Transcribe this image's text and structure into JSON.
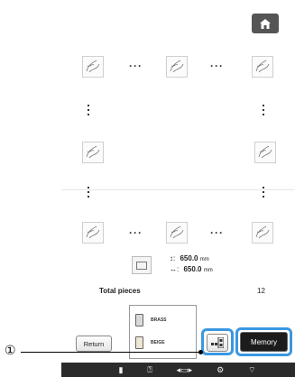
{
  "header": {
    "home_icon": "home-icon"
  },
  "layout_summary": {
    "width_value": "650.0",
    "height_value": "650.0",
    "unit": "mm",
    "total_label": "Total pieces",
    "total_value": "12"
  },
  "threads": [
    {
      "name": "BRASS"
    },
    {
      "name": "BEIGE"
    }
  ],
  "buttons": {
    "return_label": "Return",
    "memory_label": "Memory",
    "layout_icon": "grid-layout-icon"
  },
  "callout": {
    "number": "①"
  },
  "statusbar": {
    "icons": [
      "file-icon",
      "help-icon",
      "hoop-size-icon",
      "settings-icon",
      "wifi-icon"
    ]
  },
  "colors": {
    "highlight": "#3b97e0",
    "memory_bg": "#1c1c1c",
    "statusbar_bg": "#2b2b2b"
  }
}
